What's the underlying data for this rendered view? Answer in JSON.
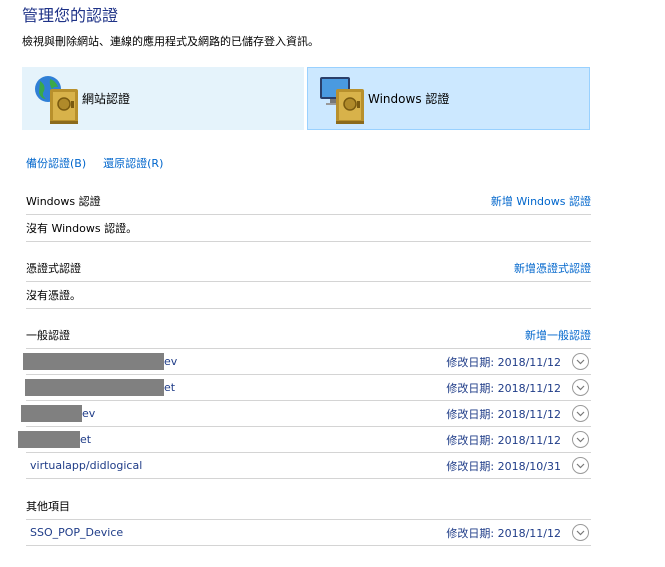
{
  "header": {
    "title": "管理您的認證",
    "subtitle": "檢視與刪除網站、連線的應用程式及網路的已儲存登入資訊。"
  },
  "tiles": {
    "web": {
      "label": "網站認證",
      "icon": "web-credential-vault-icon"
    },
    "windows": {
      "label": "Windows 認證",
      "icon": "windows-credential-vault-icon",
      "selected": true
    }
  },
  "actions": {
    "backup": "備份認證(B)",
    "restore": "還原認證(R)"
  },
  "windows_section": {
    "title": "Windows 認證",
    "add": "新增 Windows 認證",
    "empty": "沒有 Windows 認證。"
  },
  "cert_section": {
    "title": "憑證式認證",
    "add": "新增憑證式認證",
    "empty": "沒有憑證。"
  },
  "generic_section": {
    "title": "一般認證",
    "add": "新增一般認證",
    "items": [
      {
        "name_suffix": "ev",
        "date_label": "修改日期:",
        "date": "2018/11/12"
      },
      {
        "name_suffix": "et",
        "date_label": "修改日期:",
        "date": "2018/11/12"
      },
      {
        "name_suffix": "ev",
        "date_label": "修改日期:",
        "date": "2018/11/12"
      },
      {
        "name_suffix": "et",
        "date_label": "修改日期:",
        "date": "2018/11/12"
      },
      {
        "name": "virtualapp/didlogical",
        "date_label": "修改日期:",
        "date": "2018/10/31"
      }
    ]
  },
  "other_section": {
    "title": "其他項目",
    "items": [
      {
        "name": "SSO_POP_Device",
        "date_label": "修改日期:",
        "date": "2018/11/12"
      }
    ]
  },
  "colors": {
    "title": "#1e3287",
    "link": "#0066cc",
    "tile_web_bg": "#e5f3fb",
    "tile_selected_bg": "#cce8ff",
    "redaction": "#808080"
  }
}
